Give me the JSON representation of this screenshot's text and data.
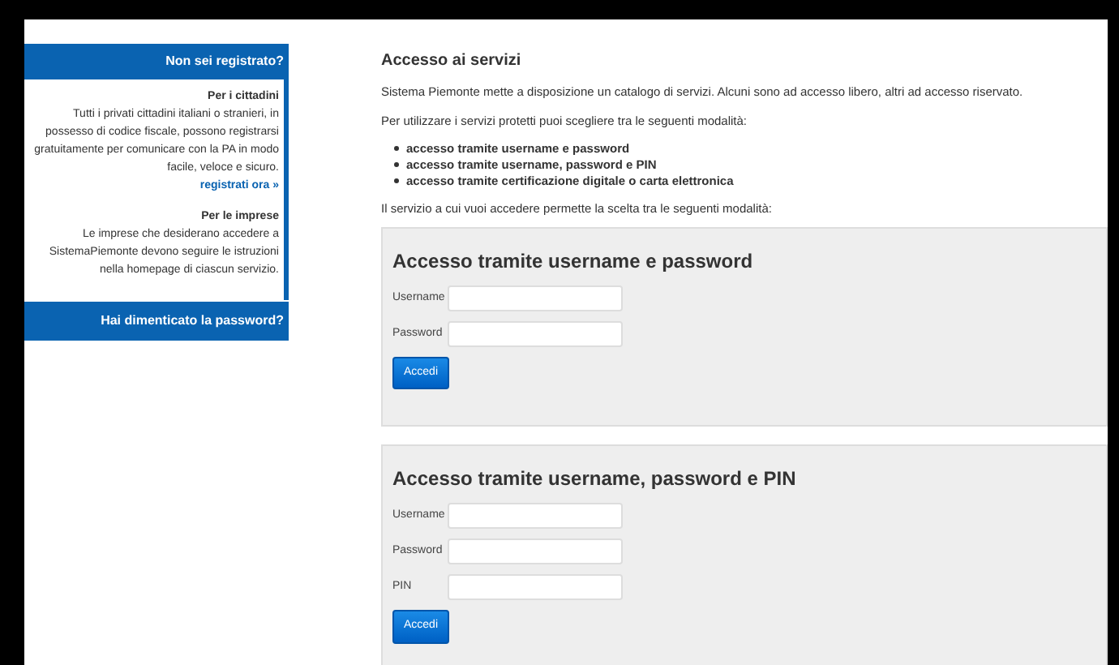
{
  "sidebar": {
    "header": "Non sei registrato?",
    "sections": [
      {
        "title": "Per i cittadini",
        "text": "Tutti i privati cittadini italiani o stranieri, in possesso di codice fiscale, possono registrarsi gratuitamente per comunicare con la PA in modo facile, veloce e sicuro.",
        "link": "registrati ora »"
      },
      {
        "title": "Per le imprese",
        "text": "Le imprese che desiderano accedere a SistemaPiemonte devono seguire le istruzioni nella homepage di ciascun servizio."
      }
    ],
    "footer": "Hai dimenticato la password?"
  },
  "main": {
    "title": "Accesso ai servizi",
    "intro": "Sistema Piemonte mette a disposizione un catalogo di servizi. Alcuni sono ad accesso libero, altri ad accesso riservato.",
    "lead": "Per utilizzare i servizi protetti puoi scegliere tra le seguenti modalità:",
    "options": [
      "accesso tramite username e password",
      "accesso tramite username, password e PIN",
      "accesso tramite certificazione digitale o carta elettronica"
    ],
    "note": "Il servizio a cui vuoi accedere permette la scelta tra le seguenti modalità:",
    "panels": [
      {
        "title": "Accesso tramite username e password",
        "fields": [
          "Username",
          "Password"
        ],
        "button": "Accedi"
      },
      {
        "title": "Accesso tramite username, password e PIN",
        "fields": [
          "Username",
          "Password",
          "PIN"
        ],
        "button": "Accedi"
      }
    ]
  }
}
